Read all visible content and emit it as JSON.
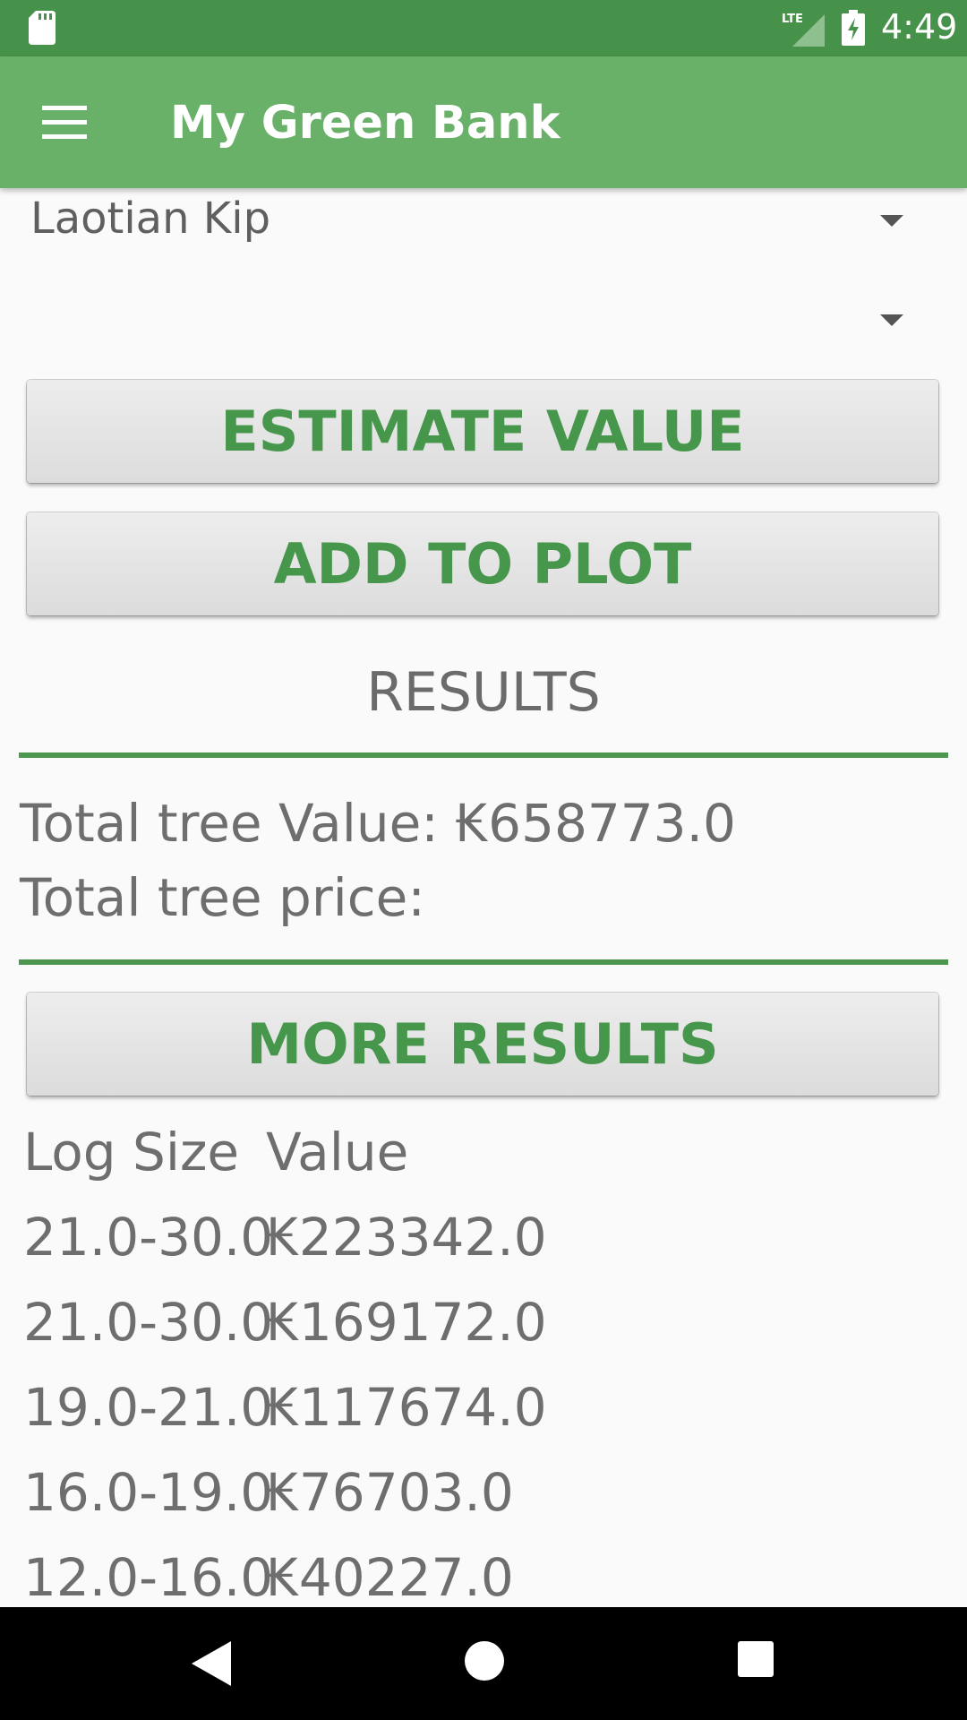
{
  "status_bar": {
    "time": "4:49",
    "network": "LTE"
  },
  "app_bar": {
    "title": "My Green Bank"
  },
  "spinners": {
    "currency": "Laotian Kip",
    "second": ""
  },
  "buttons": {
    "estimate": "ESTIMATE VALUE",
    "add_to_plot": "ADD TO PLOT",
    "more_results": "MORE RESULTS"
  },
  "results": {
    "heading": "RESULTS",
    "total_value": "Total tree Value: ₭658773.0",
    "total_price": "Total tree price:"
  },
  "log_table": {
    "headers": {
      "size": "Log Size",
      "value": "Value"
    },
    "rows": [
      {
        "size": "21.0-30.0",
        "value": "₭223342.0"
      },
      {
        "size": "21.0-30.0",
        "value": "₭169172.0"
      },
      {
        "size": "19.0-21.0",
        "value": "₭117674.0"
      },
      {
        "size": "16.0-19.0",
        "value": "₭76703.0"
      },
      {
        "size": "12.0-16.0",
        "value": "₭40227.0"
      }
    ]
  },
  "colors": {
    "primary": "#69b068",
    "primary_dark": "#47924a",
    "accent_text": "#46974b"
  }
}
